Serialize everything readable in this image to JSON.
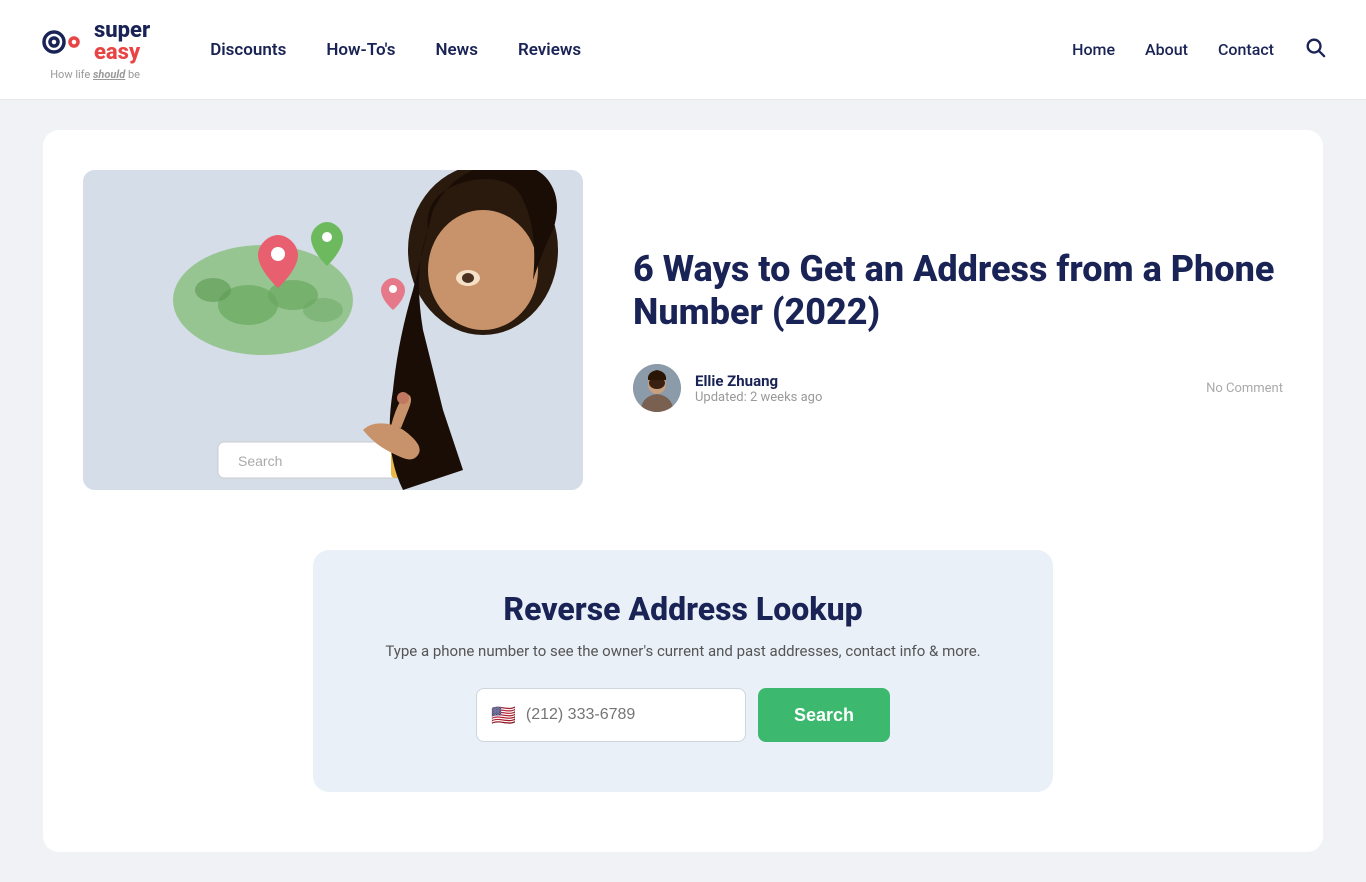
{
  "header": {
    "logo": {
      "super": "super",
      "easy": "easy",
      "tagline_prefix": "How life ",
      "tagline_emphasis": "should",
      "tagline_suffix": " be"
    },
    "nav": [
      {
        "label": "Discounts",
        "href": "#"
      },
      {
        "label": "How-To's",
        "href": "#"
      },
      {
        "label": "News",
        "href": "#"
      },
      {
        "label": "Reviews",
        "href": "#"
      }
    ],
    "right_nav": [
      {
        "label": "Home",
        "href": "#"
      },
      {
        "label": "About",
        "href": "#"
      },
      {
        "label": "Contact",
        "href": "#"
      }
    ]
  },
  "article": {
    "title": "6 Ways to Get an Address from a Phone Number (2022)",
    "author_name": "Ellie Zhuang",
    "author_date": "Updated: 2 weeks ago",
    "no_comment": "No Comment"
  },
  "widget": {
    "title": "Reverse Address Lookup",
    "subtitle": "Type a phone number to see the owner's current and past addresses, contact info & more.",
    "input_placeholder": "(212) 333-6789",
    "search_label": "Search"
  }
}
